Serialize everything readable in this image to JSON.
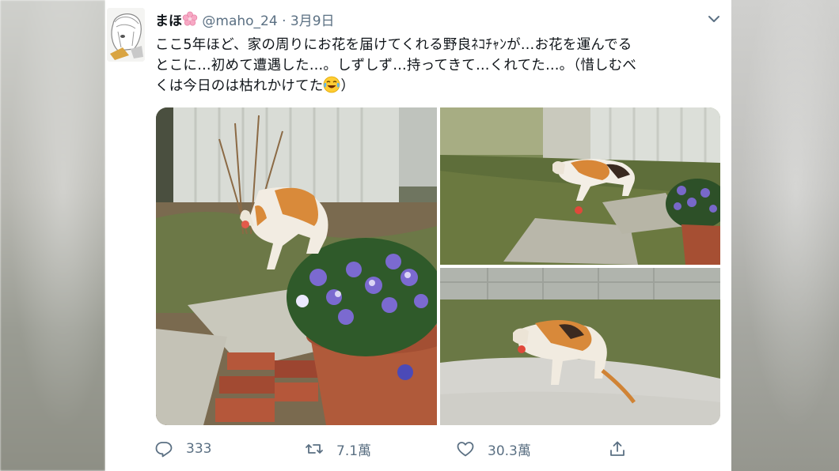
{
  "tweet": {
    "display_name": "まほ",
    "handle": "@maho_24",
    "separator": "·",
    "date": "3月9日",
    "text_lines": [
      "ここ5年ほど、家の周りにお花を届けてくれる野良ﾈｺﾁｬﾝが…お花を運んでる",
      "とこに…初めて遭遇した…。しずしず…持ってきて…くれてた…。（惜しむべ",
      "くは今日のは枯れかけてた",
      "）"
    ],
    "emojis": {
      "name_suffix": "cherry-blossom",
      "text_end": "face-with-tears-of-joy"
    }
  },
  "media": {
    "images": [
      {
        "description": "calico cat carrying a flower past pansies in a pot"
      },
      {
        "description": "calico cat walking on grass near a garden wall"
      },
      {
        "description": "calico cat walking on pavement with a flower in its mouth"
      }
    ]
  },
  "actions": {
    "reply_count": "333",
    "retweet_count": "7.1萬",
    "like_count": "30.3萬"
  },
  "colors": {
    "text": "#0f1419",
    "secondary": "#5b7083",
    "background": "#ffffff"
  }
}
